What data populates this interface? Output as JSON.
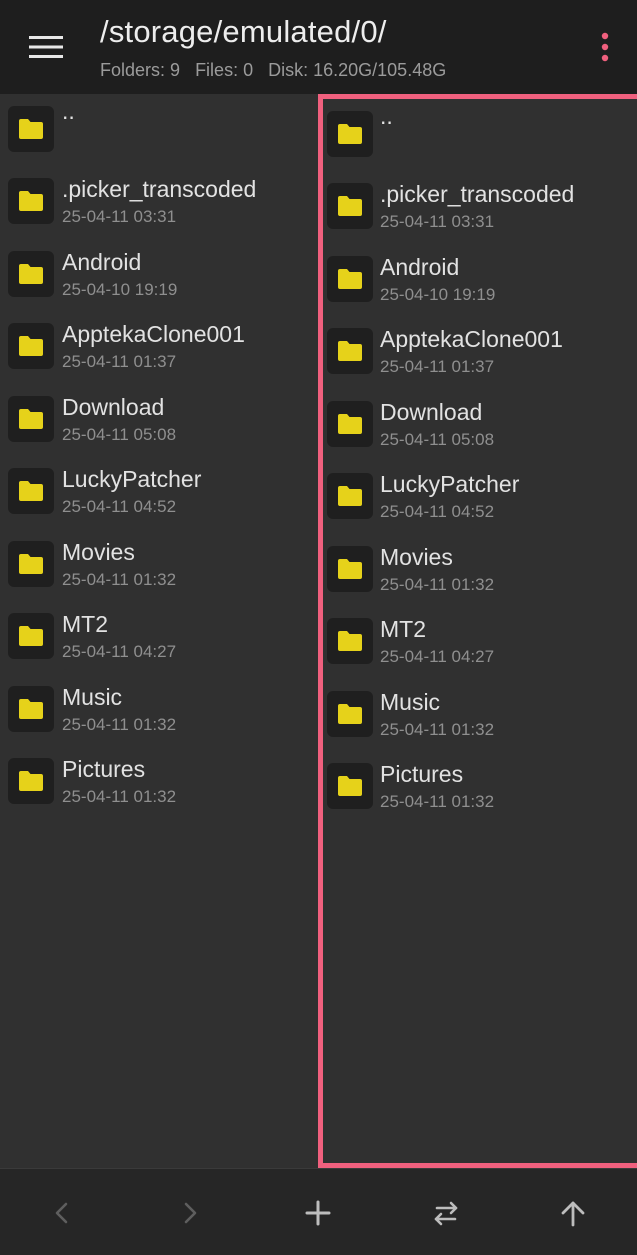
{
  "header": {
    "path": "/storage/emulated/0/",
    "stats": {
      "folders": "Folders: 9",
      "files": "Files: 0",
      "disk": "Disk: 16.20G/105.48G"
    },
    "menu_icon": "hamburger-menu-icon",
    "more_icon": "more-vert-icon",
    "accent_color": "#f0607e"
  },
  "panes": {
    "left": {
      "parent_label": "..",
      "items": [
        {
          "name": ".picker_transcoded",
          "date": "25-04-11 03:31"
        },
        {
          "name": "Android",
          "date": "25-04-10 19:19"
        },
        {
          "name": "ApptekaClone001",
          "date": "25-04-11 01:37"
        },
        {
          "name": "Download",
          "date": "25-04-11 05:08"
        },
        {
          "name": "LuckyPatcher",
          "date": "25-04-11 04:52"
        },
        {
          "name": "Movies",
          "date": "25-04-11 01:32"
        },
        {
          "name": "MT2",
          "date": "25-04-11 04:27"
        },
        {
          "name": "Music",
          "date": "25-04-11 01:32"
        },
        {
          "name": "Pictures",
          "date": "25-04-11 01:32"
        }
      ]
    },
    "right": {
      "active": true,
      "parent_label": "..",
      "items": [
        {
          "name": ".picker_transcoded",
          "date": "25-04-11 03:31"
        },
        {
          "name": "Android",
          "date": "25-04-10 19:19"
        },
        {
          "name": "ApptekaClone001",
          "date": "25-04-11 01:37"
        },
        {
          "name": "Download",
          "date": "25-04-11 05:08"
        },
        {
          "name": "LuckyPatcher",
          "date": "25-04-11 04:52"
        },
        {
          "name": "Movies",
          "date": "25-04-11 01:32"
        },
        {
          "name": "MT2",
          "date": "25-04-11 04:27"
        },
        {
          "name": "Music",
          "date": "25-04-11 01:32"
        },
        {
          "name": "Pictures",
          "date": "25-04-11 01:32"
        }
      ]
    },
    "folder_color": "#e6d21a"
  },
  "bottom_nav": {
    "back_icon": "chevron-left-icon",
    "forward_icon": "chevron-right-icon",
    "add_icon": "plus-icon",
    "swap_icon": "swap-horizontal-icon",
    "up_icon": "arrow-up-icon"
  }
}
